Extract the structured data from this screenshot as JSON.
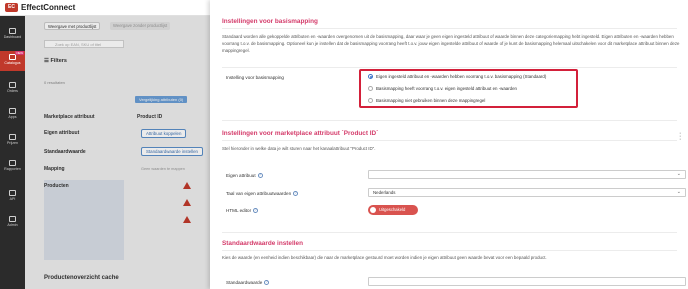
{
  "app": {
    "name": "EffectConnect",
    "logo_letters": "EC"
  },
  "nav": {
    "new_badge": "NEW",
    "items": [
      {
        "label": "Dashboard",
        "icon": "dashboard-icon"
      },
      {
        "label": "Catalogus",
        "icon": "catalog-icon"
      },
      {
        "label": "Orders",
        "icon": "orders-icon"
      },
      {
        "label": "Apps",
        "icon": "apps-icon"
      },
      {
        "label": "Prijzen",
        "icon": "prices-icon"
      },
      {
        "label": "Rapporten",
        "icon": "reports-icon"
      },
      {
        "label": "API",
        "icon": "api-icon"
      },
      {
        "label": "Admin",
        "icon": "admin-icon"
      }
    ]
  },
  "background": {
    "view_tabs": [
      "Weergave met productlijst",
      "Weergave zonder productlijst"
    ],
    "search_placeholder": "Zoek op EAN, SKU of titel",
    "filters_label": "Filters",
    "results_text": "0 resultaten",
    "compare_tag": "Vergelijking attributen (0)",
    "rows": {
      "marketplace_attr": "Marketplace attribuut",
      "own_attr": "Eigen attribuut",
      "default_value": "Standaardwaarde",
      "mapping": "Mapping",
      "products": "Producten",
      "product_id": "Product ID"
    },
    "link_attr_button": "Attribuut koppelen",
    "default_value_button": "Standaardwaarde instellen",
    "no_values_text": "Geen waarden te mappen",
    "cache_title": "Productenoverzicht cache"
  },
  "panel": {
    "basismapping": {
      "title": "Instellingen voor basismapping",
      "description": "Standaard worden alle gekoppelde attributen en -waarden overgenomen uit de basismapping, daar waar je geen eigen ingesteld attribuut of waarde binnen deze categoriemapping hebt ingesteld. Eigen attributen en -waarden hebben voorrang t.o.v. de basismapping. Optioneel kun je instellen dat de basismapping voorrang heeft t.o.v. jouw eigen ingestelde attribuut of waarde of je kunt de basismapping helemaal uitschakelen voor dit marketplace attribuut binnen deze mappingregel.",
      "setting_label": "Instelling voor basismapping",
      "options": [
        "Eigen ingesteld attribuut en -waarden hebben voorrang t.o.v. basismapping (Standaard)",
        "Basismapping heeft voorrang t.o.v. eigen ingesteld attribuut en -waarden",
        "Basismapping niet gebruiken binnen deze mappingregel"
      ],
      "selected_index": 0
    },
    "marketplace_attr": {
      "title": "Instellingen voor marketplace attribuut `Product ID`",
      "description": "Stel hieronder in welke data je wilt sturen naar het kanaalattribuut \"Product ID\".",
      "own_attr_label": "Eigen attribuut",
      "own_attr_value": "",
      "lang_label": "Taal van eigen attribuutwaarden",
      "lang_value": "Nederlands",
      "html_label": "HTML editor",
      "html_toggle": "Uitgeschakeld"
    },
    "default_value": {
      "title": "Standaardwaarde instellen",
      "description": "Kies de waarde (en eenheid indien beschikbaar) die naar de marketplace gestuurd moet worden indien je eigen attribuut geen waarde bevat voor een bepaald product.",
      "label": "Standaardwaarde",
      "value": ""
    }
  },
  "colors": {
    "accent": "#d43b6a",
    "highlight_border": "#d3203a",
    "nav_bg": "#2b2b2b",
    "toggle_off": "#d9534f"
  }
}
